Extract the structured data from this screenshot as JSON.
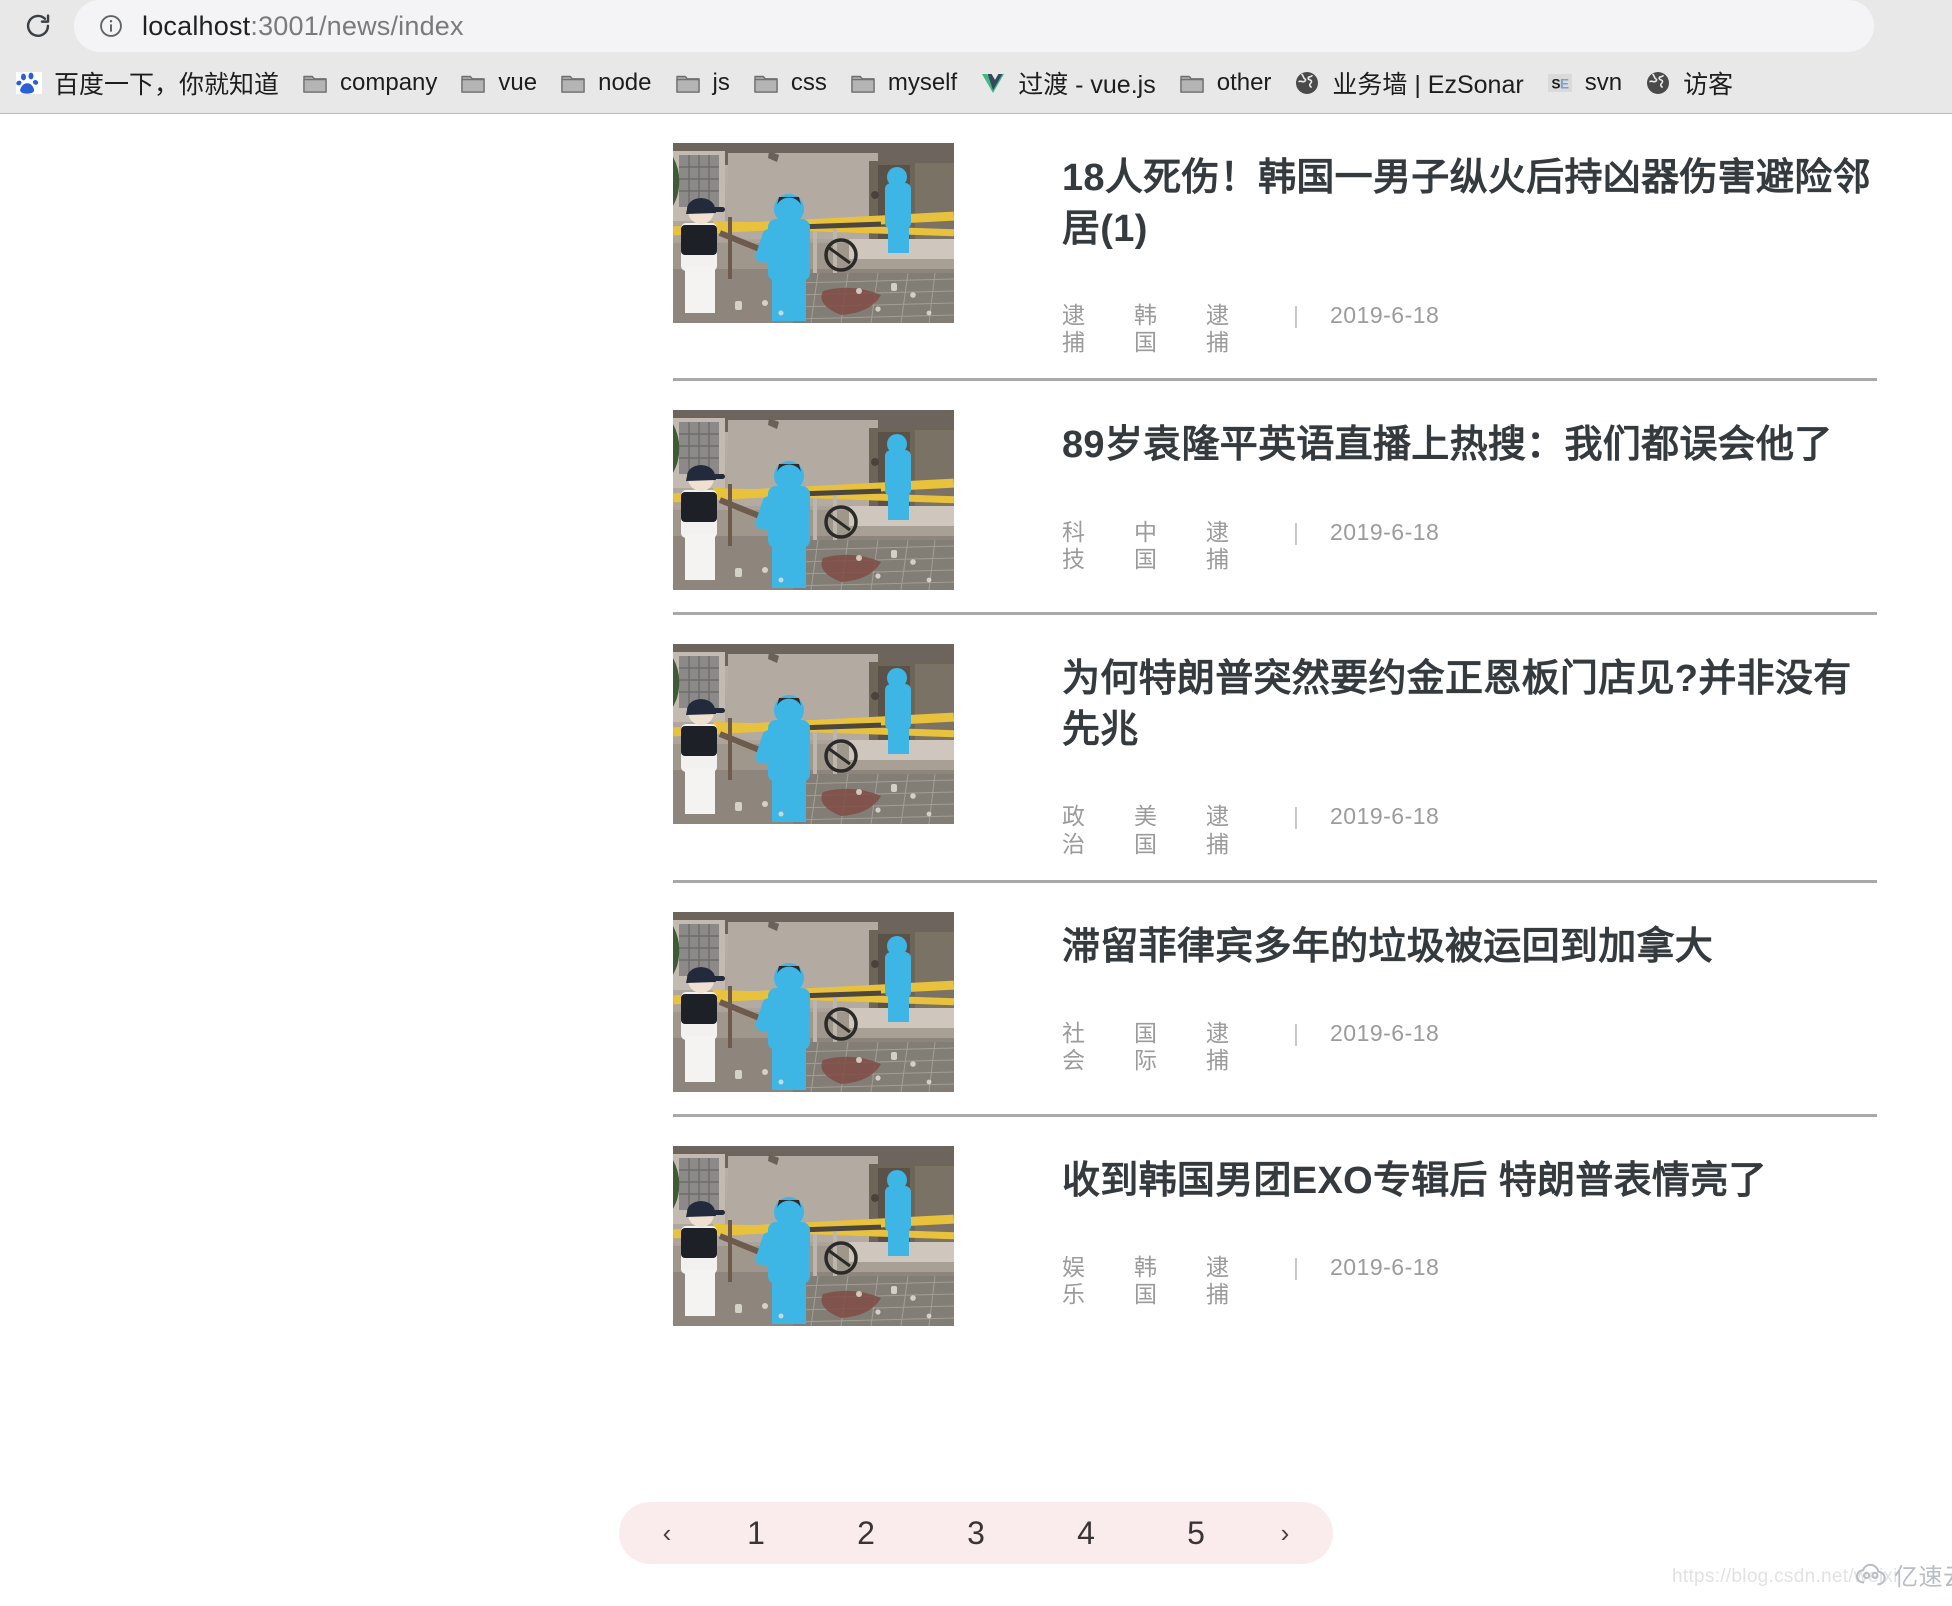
{
  "browser": {
    "reload_icon": "reload-icon",
    "info_icon": "info-circle-icon",
    "url_host": "localhost",
    "url_path": ":3001/news/index",
    "url_full": "localhost:3001/news/index",
    "bookmarks": [
      {
        "label": "百度一下，你就知道",
        "icon": "baidu-paw-icon",
        "cjk": true
      },
      {
        "label": "company",
        "icon": "folder-icon",
        "cjk": false
      },
      {
        "label": "vue",
        "icon": "folder-icon",
        "cjk": false
      },
      {
        "label": "node",
        "icon": "folder-icon",
        "cjk": false
      },
      {
        "label": "js",
        "icon": "folder-icon",
        "cjk": false
      },
      {
        "label": "css",
        "icon": "folder-icon",
        "cjk": false
      },
      {
        "label": "myself",
        "icon": "folder-icon",
        "cjk": false
      },
      {
        "label": "过渡 - vue.js",
        "icon": "vue-logo-icon",
        "cjk": true
      },
      {
        "label": "other",
        "icon": "folder-icon",
        "cjk": false
      },
      {
        "label": "业务墙 | EzSonar",
        "icon": "globe-icon",
        "cjk": true
      },
      {
        "label": "svn",
        "icon": "se-icon",
        "cjk": false
      },
      {
        "label": "访客",
        "icon": "globe-icon",
        "cjk": true
      }
    ]
  },
  "news": {
    "items": [
      {
        "title": "18人死伤！韩国一男子纵火后持凶器伤害避险邻居(1)",
        "tags": [
          "逮捕",
          "韩国",
          "逮捕"
        ],
        "separator": "|",
        "date": "2019-6-18",
        "thumb_alt": "crime-scene-photo"
      },
      {
        "title": "89岁袁隆平英语直播上热搜：我们都误会他了",
        "tags": [
          "科技",
          "中国",
          "逮捕"
        ],
        "separator": "|",
        "date": "2019-6-18",
        "thumb_alt": "crime-scene-photo"
      },
      {
        "title": "为何特朗普突然要约金正恩板门店见?并非没有先兆",
        "tags": [
          "政治",
          "美国",
          "逮捕"
        ],
        "separator": "|",
        "date": "2019-6-18",
        "thumb_alt": "crime-scene-photo"
      },
      {
        "title": "滞留菲律宾多年的垃圾被运回到加拿大",
        "tags": [
          "社会",
          "国际",
          "逮捕"
        ],
        "separator": "|",
        "date": "2019-6-18",
        "thumb_alt": "crime-scene-photo"
      },
      {
        "title": "收到韩国男团EXO专辑后 特朗普表情亮了",
        "tags": [
          "娱乐",
          "韩国",
          "逮捕"
        ],
        "separator": "|",
        "date": "2019-6-18",
        "thumb_alt": "crime-scene-photo"
      }
    ]
  },
  "pagination": {
    "prev": "‹",
    "next": "›",
    "pages": [
      "1",
      "2",
      "3",
      "4",
      "5"
    ],
    "background_color": "#faecec"
  },
  "watermark": {
    "url": "https://blog.csdn.net/weixi",
    "brand": "亿速云",
    "logo_icon": "cloud-icon"
  }
}
